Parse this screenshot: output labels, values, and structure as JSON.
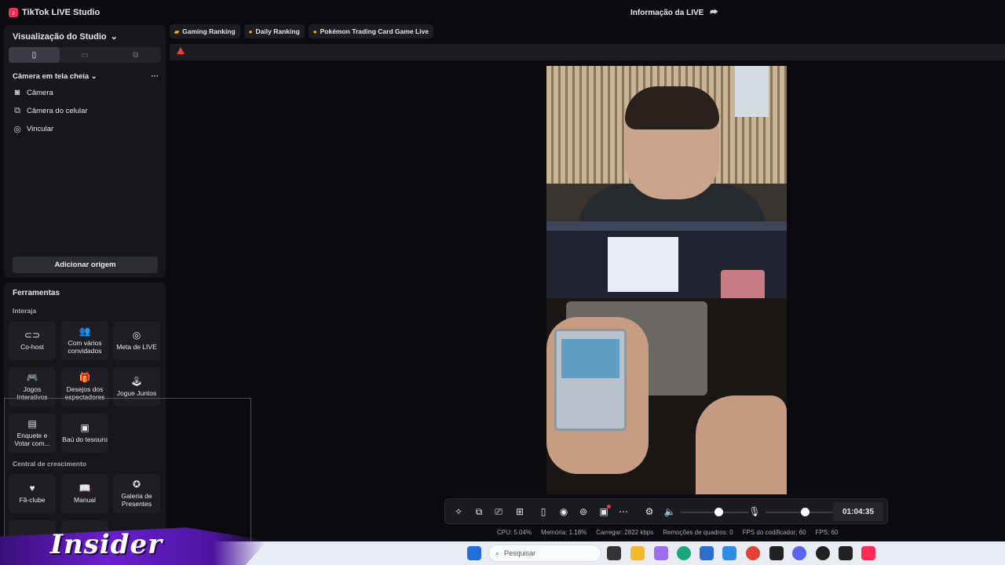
{
  "app": {
    "title": "TikTok LIVE Studio",
    "logo_glyph": "♪"
  },
  "header": {
    "live_info": "Informação da LIVE"
  },
  "studio": {
    "view_label": "Visualização do Studio",
    "scene_label": "Câmera em tela cheia",
    "more": "···",
    "sources": [
      {
        "label": "Câmera",
        "icon": "camera-icon"
      },
      {
        "label": "Câmera do celular",
        "icon": "phone-camera-icon"
      },
      {
        "label": "Vincular",
        "icon": "globe-icon"
      }
    ],
    "add_source": "Adicionar origem"
  },
  "tools": {
    "title": "Ferramentas",
    "interact_label": "Interaja",
    "growth_label": "Central de crescimento",
    "interact": [
      "Co-host",
      "Com vários convidados",
      "Meta de LIVE",
      "Jogos Interativos",
      "Desejos dos espectadores",
      "Jogue Juntos",
      "Enquete e Votar com...",
      "Baú do tesouro"
    ],
    "growth": [
      "Fã-clube",
      "Manual",
      "Galeria de Presentes"
    ]
  },
  "pills": [
    "Gaming Ranking",
    "Daily Ranking",
    "Pokémon Trading Card Game Live"
  ],
  "controls": {
    "timer": "01:04:35",
    "volume_level": 0.56,
    "mic_level": 0.58
  },
  "stats": {
    "cpu": "CPU:  5.04%",
    "memory": "Memória:  1.18%",
    "upload": "Carregar:  2822 kbps",
    "dropped": "Remoções de quadros:  0",
    "encoder_fps": "FPS do codificador:  60",
    "fps": "FPS:  60"
  },
  "taskbar": {
    "search_placeholder": "Pesquisar"
  },
  "overlay": {
    "brand": "Insider"
  },
  "colors": {
    "accent": "#fe2c55",
    "selection": "#7a22d6",
    "panel": "#16161b"
  }
}
